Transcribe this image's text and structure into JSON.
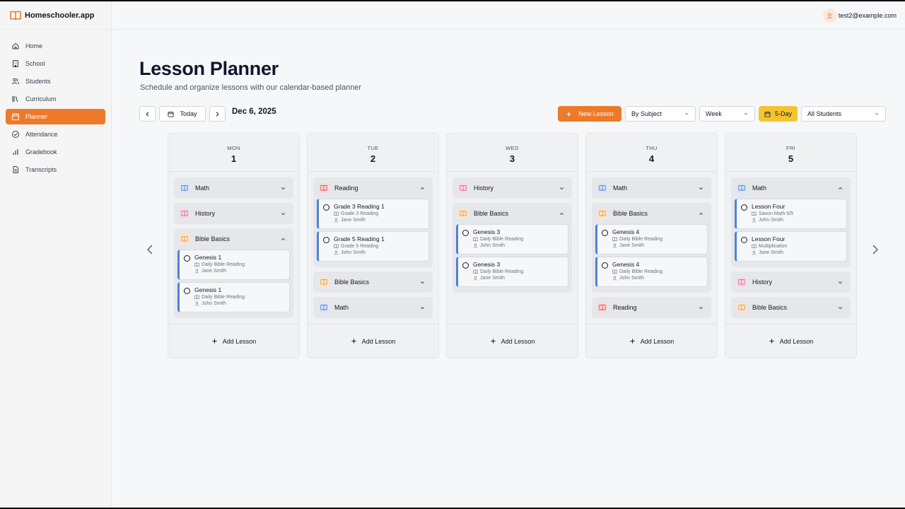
{
  "app": {
    "name": "Homeschooler.app",
    "user_email": "test2@example.com"
  },
  "sidebar": {
    "items": [
      {
        "label": "Home",
        "icon": "home-icon"
      },
      {
        "label": "School",
        "icon": "building-icon"
      },
      {
        "label": "Students",
        "icon": "users-icon"
      },
      {
        "label": "Curriculum",
        "icon": "library-icon"
      },
      {
        "label": "Planner",
        "icon": "calendar-icon",
        "active": true
      },
      {
        "label": "Attendance",
        "icon": "check-circle-icon"
      },
      {
        "label": "Gradebook",
        "icon": "bar-chart-icon"
      },
      {
        "label": "Transcripts",
        "icon": "document-icon"
      }
    ]
  },
  "page": {
    "title": "Lesson Planner",
    "subtitle": "Schedule and organize lessons with our calendar-based planner"
  },
  "toolbar": {
    "today_label": "Today",
    "date": "Dec 6, 2025",
    "new_lesson_label": "New Lesson",
    "group_by": "By Subject",
    "view": "Week",
    "five_day_label": "5-Day",
    "students_filter": "All Students"
  },
  "colors": {
    "accent": "#ed7a2a",
    "five_day": "#f4c430",
    "lesson_border": "#4a84db"
  },
  "days": [
    {
      "dow": "MON",
      "num": "1",
      "add_label": "Add Lesson",
      "groups": [
        {
          "subject": "Math",
          "color": "blue",
          "expanded": false,
          "lessons": []
        },
        {
          "subject": "History",
          "color": "pink",
          "expanded": false,
          "lessons": []
        },
        {
          "subject": "Bible Basics",
          "color": "orange",
          "expanded": true,
          "lessons": [
            {
              "title": "Genesis 1",
              "curriculum": "Daily Bible Reading",
              "student": "Jane Smith"
            },
            {
              "title": "Genesis 1",
              "curriculum": "Daily Bible Reading",
              "student": "John Smith"
            }
          ]
        }
      ]
    },
    {
      "dow": "TUE",
      "num": "2",
      "add_label": "Add Lesson",
      "groups": [
        {
          "subject": "Reading",
          "color": "red",
          "expanded": true,
          "lessons": [
            {
              "title": "Grade 3 Reading 1",
              "curriculum": "Grade 3 Reading",
              "student": "Jane Smith"
            },
            {
              "title": "Grade 5 Reading 1",
              "curriculum": "Grade 5 Reading",
              "student": "John Smith"
            }
          ]
        },
        {
          "subject": "Bible Basics",
          "color": "orange",
          "expanded": false,
          "lessons": []
        },
        {
          "subject": "Math",
          "color": "blue",
          "expanded": false,
          "lessons": []
        }
      ]
    },
    {
      "dow": "WED",
      "num": "3",
      "add_label": "Add Lesson",
      "groups": [
        {
          "subject": "History",
          "color": "pink",
          "expanded": false,
          "lessons": []
        },
        {
          "subject": "Bible Basics",
          "color": "orange",
          "expanded": true,
          "lessons": [
            {
              "title": "Genesis 3",
              "curriculum": "Daily Bible Reading",
              "student": "John Smith"
            },
            {
              "title": "Genesis 3",
              "curriculum": "Daily Bible Reading",
              "student": "Jane Smith"
            }
          ]
        }
      ]
    },
    {
      "dow": "THU",
      "num": "4",
      "add_label": "Add Lesson",
      "groups": [
        {
          "subject": "Math",
          "color": "blue",
          "expanded": false,
          "lessons": []
        },
        {
          "subject": "Bible Basics",
          "color": "orange",
          "expanded": true,
          "lessons": [
            {
              "title": "Genesis 4",
              "curriculum": "Daily Bible Reading",
              "student": "Jane Smith"
            },
            {
              "title": "Genesis 4",
              "curriculum": "Daily Bible Reading",
              "student": "John Smith"
            }
          ]
        },
        {
          "subject": "Reading",
          "color": "red",
          "expanded": false,
          "lessons": []
        }
      ]
    },
    {
      "dow": "FRI",
      "num": "5",
      "add_label": "Add Lesson",
      "groups": [
        {
          "subject": "Math",
          "color": "blue",
          "expanded": true,
          "lessons": [
            {
              "title": "Lesson Four",
              "curriculum": "Saxon Math 6/5",
              "student": "John Smith"
            },
            {
              "title": "Lesson Four",
              "curriculum": "Multiplication",
              "student": "Jane Smith"
            }
          ]
        },
        {
          "subject": "History",
          "color": "pink",
          "expanded": false,
          "lessons": []
        },
        {
          "subject": "Bible Basics",
          "color": "orange",
          "expanded": false,
          "lessons": []
        }
      ]
    }
  ]
}
